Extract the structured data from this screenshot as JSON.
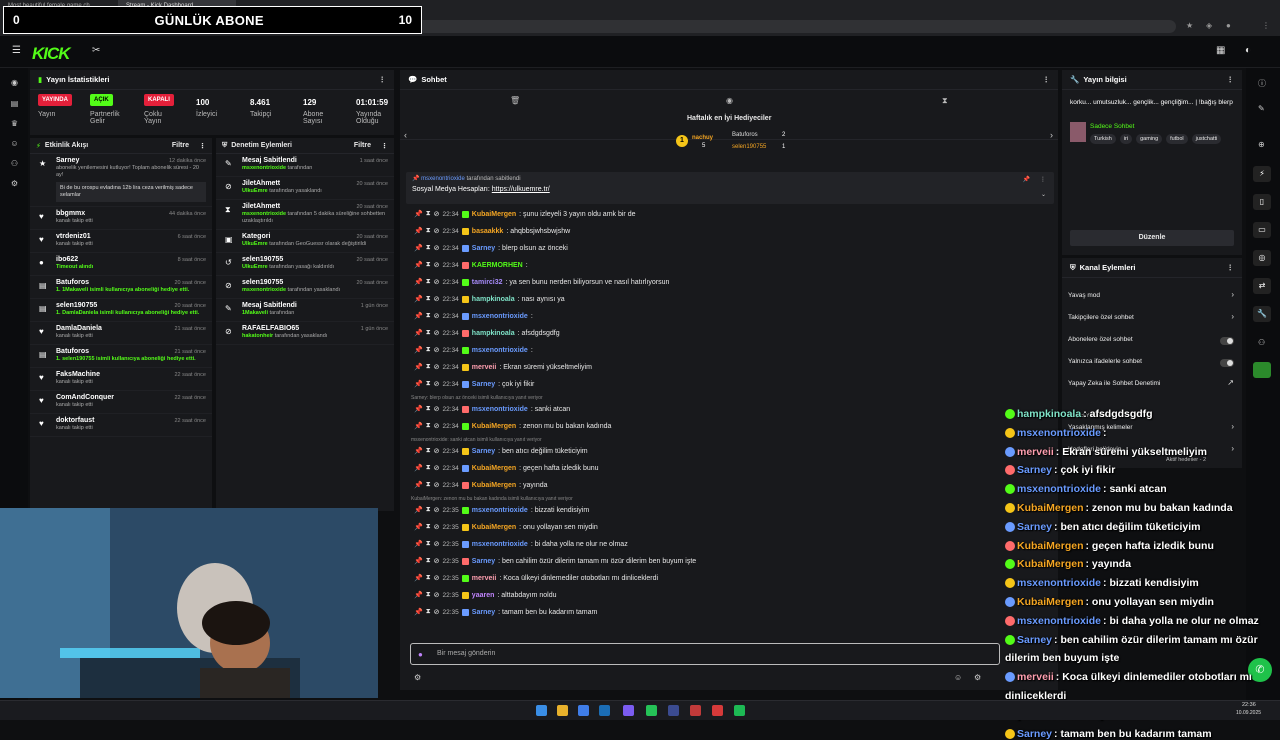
{
  "browser": {
    "tabs": [
      "Most beautiful female game ch...",
      "Stream - Kick Dashboard"
    ],
    "url": "https://dashboard.kick.com/stream"
  },
  "sub_counter": {
    "left": "0",
    "label": "GÜNLÜK ABONE",
    "right": "10"
  },
  "kick": {
    "logo": "KICK"
  },
  "stats": {
    "title": "Yayın İstatistikleri",
    "pills": [
      {
        "label": "YAYINDA",
        "caption": "Yayın",
        "bg": "#e4203a",
        "fg": "#ffffff"
      },
      {
        "label": "AÇIK",
        "caption": "Partnerlik Gelir",
        "bg": "#53fc18",
        "fg": "#000000"
      },
      {
        "label": "KAPALI",
        "caption": "Çoklu Yayın",
        "bg": "#e4203a",
        "fg": "#ffffff"
      }
    ],
    "values": [
      {
        "value": "100",
        "caption": "İzleyici"
      },
      {
        "value": "8.461",
        "caption": "Takipçi"
      },
      {
        "value": "129",
        "caption": "Abone Sayısı"
      },
      {
        "value": "01:01:59",
        "caption": "Yayında Olduğu"
      }
    ]
  },
  "activity": {
    "title": "Etkinlik Akışı",
    "filter": "Filtre",
    "events": [
      {
        "name": "Sarney",
        "time": "12 dakika önce",
        "desc": "abonelik yenilemesini kutluyor! Toplam abonelik süresi - 20 ay!",
        "msg": "Bi de bu orospu evladına 12b lira ceza verilmiş sadece selamlar",
        "icon": "★"
      },
      {
        "name": "bbgmmx",
        "time": "44 dakika önce",
        "desc": "kanalı takip etti",
        "icon": "♥"
      },
      {
        "name": "vtrdeniz01",
        "time": "6 saat önce",
        "desc": "kanalı takip etti",
        "icon": "♥"
      },
      {
        "name": "ibo622",
        "time": "8 saat önce",
        "desc": "Timeout alındı",
        "icon": "●"
      },
      {
        "name": "Batuforos",
        "time": "20 saat önce",
        "desc": "1. 1Makaveli isimli kullanıcıya aboneliği hediye etti.",
        "icon": "▤"
      },
      {
        "name": "selen190755",
        "time": "20 saat önce",
        "desc": "1. DamlaDaniela isimli kullanıcıya aboneliği hediye etti.",
        "icon": "▤"
      },
      {
        "name": "DamlaDaniela",
        "time": "21 saat önce",
        "desc": "kanalı takip etti",
        "icon": "♥"
      },
      {
        "name": "Batuforos",
        "time": "21 saat önce",
        "desc": "1. selen190755 isimli kullanıcıya aboneliği hediye etti.",
        "icon": "▤"
      },
      {
        "name": "FaksMachine",
        "time": "22 saat önce",
        "desc": "kanalı takip etti",
        "icon": "♥"
      },
      {
        "name": "ComAndConquer",
        "time": "22 saat önce",
        "desc": "kanalı takip etti",
        "icon": "♥"
      },
      {
        "name": "doktorfaust",
        "time": "22 saat önce",
        "desc": "kanalı takip etti",
        "icon": "♥"
      }
    ]
  },
  "modlog": {
    "title": "Denetim Eylemleri",
    "filter": "Filtre",
    "events": [
      {
        "name": "Mesaj Sabitlendi",
        "time": "1 saat önce",
        "actor": "msxenontrioxide",
        "desc": "tarafından",
        "icon": "✎"
      },
      {
        "name": "JiletAhmett",
        "time": "20 saat önce",
        "actor": "UlkuEmre",
        "desc": "tarafından yasaklandı",
        "icon": "⊘"
      },
      {
        "name": "JiletAhmett",
        "time": "20 saat önce",
        "actor": "msxenontrioxide",
        "desc": "tarafından 5 dakika süreliğine sohbetten uzaklaştırıldı",
        "icon": "⧗"
      },
      {
        "name": "Kategori",
        "time": "20 saat önce",
        "actor": "UlkuEmre",
        "desc": "tarafından GeoGuessr olarak değiştirildi",
        "icon": "▣"
      },
      {
        "name": "selen190755",
        "time": "20 saat önce",
        "actor": "UlkuEmre",
        "desc": "tarafından yasağı kaldırıldı",
        "icon": "↺"
      },
      {
        "name": "selen190755",
        "time": "20 saat önce",
        "actor": "msxenontrioxide",
        "desc": "tarafından yasaklandı",
        "icon": "⊘"
      },
      {
        "name": "Mesaj Sabitlendi",
        "time": "1 gün önce",
        "actor": "1Makaveli",
        "desc": "tarafından",
        "icon": "✎"
      },
      {
        "name": "RAFAELFABIO65",
        "time": "1 gün önce",
        "actor": "hakatonheir",
        "desc": "tarafından yasaklandı",
        "icon": "⊘"
      }
    ]
  },
  "chat": {
    "title": "Sohbet",
    "gifters_title": "Haftalık en İyi Hediyeciler",
    "gifters": [
      {
        "name": "nachuy",
        "count": "5"
      },
      {
        "name": "Batuforos",
        "count": "2"
      },
      {
        "name": "selen190755",
        "count": "1"
      }
    ],
    "pinned_by": "msxenontrioxide",
    "pinned_by_suffix": "tarafından sabitlendi",
    "pinned_text": "Sosyal Medya Hesapları:",
    "pinned_link": "https://ulkuemre.tr/",
    "placeholder": "Bir mesaj gönderin",
    "messages": [
      {
        "time": "22:34",
        "user": "KubaiMergen",
        "color": "#f5a623",
        "text": ": şunu izleyeli 3 yayın oldu amk bir de"
      },
      {
        "time": "22:34",
        "user": "basaakkk",
        "color": "#f5a623",
        "text": ": ahqbbsjwhsbwjshw"
      },
      {
        "time": "22:34",
        "user": "Sarney",
        "color": "#6a9bff",
        "text": ": blerp olsun az önceki"
      },
      {
        "time": "22:34",
        "user": "KAERMORHEN",
        "color": "#53fc18",
        "text": ":"
      },
      {
        "time": "22:34",
        "user": "tamirci32",
        "color": "#a78bfa",
        "text": ": ya sen bunu nerden biliyorsun ve nasıl hatırlıyorsun"
      },
      {
        "time": "22:34",
        "user": "hampkinoala",
        "color": "#7fe3c8",
        "text": ": nası aynısı ya"
      },
      {
        "time": "22:34",
        "user": "msxenontrioxide",
        "color": "#6a9bff",
        "text": ":"
      },
      {
        "time": "22:34",
        "user": "hampkinoala",
        "color": "#7fe3c8",
        "text": ": afsdgdsgdfg"
      },
      {
        "time": "22:34",
        "user": "msxenontrioxide",
        "color": "#6a9bff",
        "text": ":"
      },
      {
        "time": "22:34",
        "user": "merveii",
        "color": "#ff9fb0",
        "text": ": Ekran süremi yükseltmeliyim"
      },
      {
        "time": "22:34",
        "user": "Sarney",
        "color": "#6a9bff",
        "text": ": çok iyi fikir"
      },
      {
        "time": "22:34",
        "user": "msxenontrioxide",
        "color": "#6a9bff",
        "text": ": sanki atcan",
        "reply": "Sarney: blerp olsun az önceki isimli kullanıcıya yanıt veriyor"
      },
      {
        "time": "22:34",
        "user": "KubaiMergen",
        "color": "#f5a623",
        "text": ": zenon mu bu bakan kadında"
      },
      {
        "time": "22:34",
        "user": "Sarney",
        "color": "#6a9bff",
        "text": ": ben atıcı değilim tüketiciyim",
        "reply": "msxenontrioxide: sanki atcan isimli kullanıcıya yanıt veriyor"
      },
      {
        "time": "22:34",
        "user": "KubaiMergen",
        "color": "#f5a623",
        "text": ": geçen hafta izledik bunu"
      },
      {
        "time": "22:34",
        "user": "KubaiMergen",
        "color": "#f5a623",
        "text": ": yayında"
      },
      {
        "time": "22:35",
        "user": "msxenontrioxide",
        "color": "#6a9bff",
        "text": ": bizzati kendisiyim",
        "reply": "KubaiMergen: zenon mu bu bakan kadında isimli kullanıcıya yanıt veriyor"
      },
      {
        "time": "22:35",
        "user": "KubaiMergen",
        "color": "#f5a623",
        "text": ": onu yollayan sen miydin"
      },
      {
        "time": "22:35",
        "user": "msxenontrioxide",
        "color": "#6a9bff",
        "text": ": bi daha yolla ne olur ne olmaz"
      },
      {
        "time": "22:35",
        "user": "Sarney",
        "color": "#6a9bff",
        "text": ": ben cahilim özür dilerim tamam mı özür dilerim ben buyum işte"
      },
      {
        "time": "22:35",
        "user": "merveii",
        "color": "#ff9fb0",
        "text": ": Koca ülkeyi dinlemediler otobotları mı dinliceklerdi"
      },
      {
        "time": "22:35",
        "user": "yaaren",
        "color": "#c084fc",
        "text": ": alttabdayım noldu"
      },
      {
        "time": "22:35",
        "user": "Sarney",
        "color": "#6a9bff",
        "text": ": tamam ben bu kadarım tamam"
      }
    ]
  },
  "stream_info": {
    "title": "Yayın bilgisi",
    "stream_title": "korku... umutsuzluk... gençlik... gençliğim... | !bağış blerp",
    "category": "Sadece Sohbet",
    "tags": [
      "Turkish",
      "iri",
      "gaming",
      "futbol",
      "justchatti"
    ],
    "edit": "Düzenle"
  },
  "channel_actions": {
    "title": "Kanal Eylemleri",
    "items": [
      {
        "label": "Yavaş mod",
        "control": "arrow"
      },
      {
        "label": "Takipçilere özel sohbet",
        "control": "arrow"
      },
      {
        "label": "Abonelere özel sohbet",
        "control": "toggle"
      },
      {
        "label": "Yalnızca ifadelerle sohbet",
        "control": "toggle"
      },
      {
        "label": "Yapay Zeka ile Sohbet Denetimi",
        "control": "link"
      },
      {
        "label": "Yasaklanmış kelimeler",
        "control": "arrow"
      },
      {
        "label": "Hedefleri belirleyin",
        "control": "arrow"
      }
    ],
    "extra_1": "İzleyici Yönlendir",
    "extra_2": "Aktif hedefler - 2"
  },
  "overlay_chat": [
    {
      "user": "hampkinoala",
      "color": "#7fe3c8",
      "text": ": afsdgdsgdfg"
    },
    {
      "user": "msxenontrioxide",
      "color": "#6a9bff",
      "text": ":"
    },
    {
      "user": "merveii",
      "color": "#ff9fb0",
      "text": ": Ekran süremi yükseltmeliyim"
    },
    {
      "user": "Sarney",
      "color": "#6a9bff",
      "text": ": çok iyi fikir"
    },
    {
      "user": "msxenontrioxide",
      "color": "#6a9bff",
      "text": ": sanki atcan"
    },
    {
      "user": "KubaiMergen",
      "color": "#f5a623",
      "text": ": zenon mu bu bakan kadında"
    },
    {
      "user": "Sarney",
      "color": "#6a9bff",
      "text": ": ben atıcı değilim tüketiciyim"
    },
    {
      "user": "KubaiMergen",
      "color": "#f5a623",
      "text": ": geçen hafta izledik bunu"
    },
    {
      "user": "KubaiMergen",
      "color": "#f5a623",
      "text": ": yayında"
    },
    {
      "user": "msxenontrioxide",
      "color": "#6a9bff",
      "text": ": bizzati kendisiyim"
    },
    {
      "user": "KubaiMergen",
      "color": "#f5a623",
      "text": ": onu yollayan sen miydin"
    },
    {
      "user": "msxenontrioxide",
      "color": "#6a9bff",
      "text": ": bi daha yolla ne olur ne olmaz"
    },
    {
      "user": "Sarney",
      "color": "#6a9bff",
      "text": ": ben cahilim özür dilerim tamam mı özür"
    },
    {
      "user": "",
      "color": "#ffffff",
      "text": "dilerim ben buyum işte"
    },
    {
      "user": "merveii",
      "color": "#ff9fb0",
      "text": ": Koca ülkeyi dinlemediler otobotları mı"
    },
    {
      "user": "",
      "color": "#ffffff",
      "text": "dinliceklerdi"
    },
    {
      "user": "yaaren",
      "color": "#c084fc",
      "text": ": alttabdayım noldu"
    },
    {
      "user": "Sarney",
      "color": "#6a9bff",
      "text": ": tamam ben bu kadarım tamam"
    }
  ],
  "taskbar": {
    "time": "22:36",
    "date": "10.09.2025"
  },
  "colors": {
    "kick_green": "#53fc18",
    "live_red": "#e4203a",
    "panel": "#18191c"
  }
}
